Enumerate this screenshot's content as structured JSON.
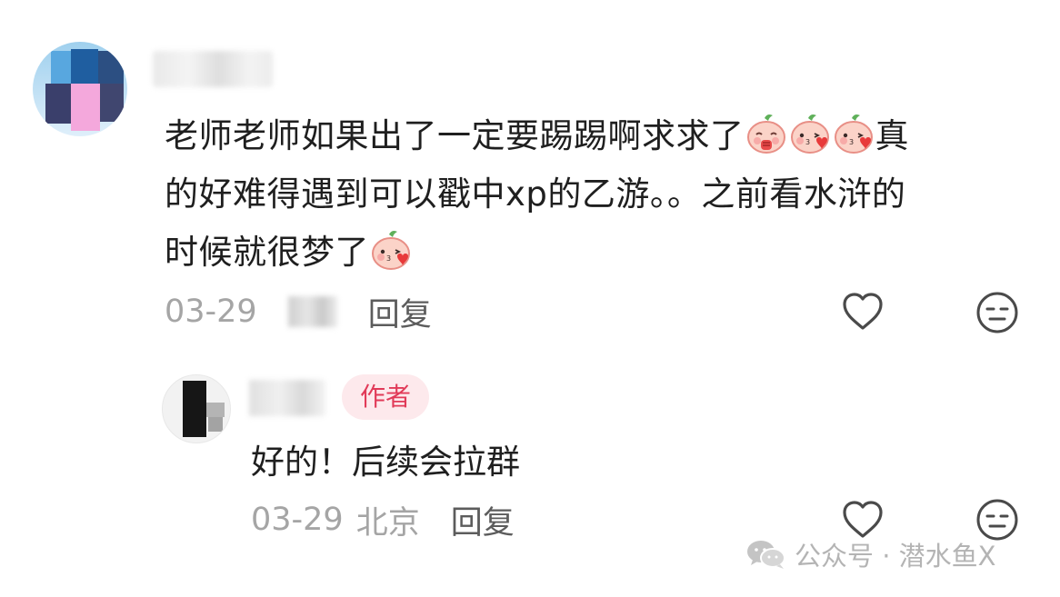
{
  "comment": {
    "text_line1": "老师老师如果出了一定要踢踢啊求求了",
    "text_line1_tail": "真",
    "text_line2": "的好难得遇到可以戳中xp的乙游。。之前看水浒的",
    "text_line3": "时候就很梦了",
    "date": "03-29",
    "reply_label": "回复",
    "emoji_names": [
      "pleading-peach-emoji",
      "kiss-heart-peach-emoji"
    ]
  },
  "reply": {
    "author_badge": "作者",
    "text": "好的！后续会拉群",
    "date": "03-29",
    "location": "北京",
    "reply_label": "回复"
  },
  "icons": {
    "like": "heart-outline-icon",
    "reaction": "neutral-face-icon",
    "watermark_logo": "wechat-icon"
  },
  "watermark": {
    "text": "公众号 · 潜水鱼X"
  },
  "colors": {
    "text": "#1f1f1f",
    "meta": "#a5a5a5",
    "badge_bg": "#fde9ec",
    "badge_fg": "#e13a58"
  }
}
